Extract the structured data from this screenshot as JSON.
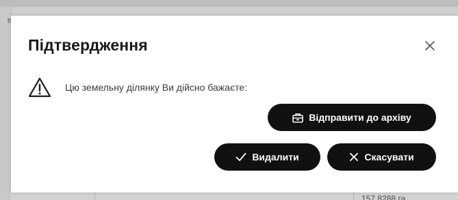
{
  "dialog": {
    "title": "Підтвердження",
    "message": "Цю земельну ділянку Ви дійсно бажаєте:",
    "buttons": {
      "archive": "Відправити до архіву",
      "delete": "Видалити",
      "cancel": "Скасувати"
    },
    "icons": {
      "close": "close-icon",
      "warning": "warning-icon",
      "archive": "archive-box-icon",
      "delete": "check-icon",
      "cancel": "x-icon"
    }
  },
  "background": {
    "stub_letter": "В",
    "partial_value": "157 8288 га"
  },
  "colors": {
    "button_bg": "#111111",
    "button_text": "#ffffff",
    "modal_bg": "#ffffff"
  }
}
